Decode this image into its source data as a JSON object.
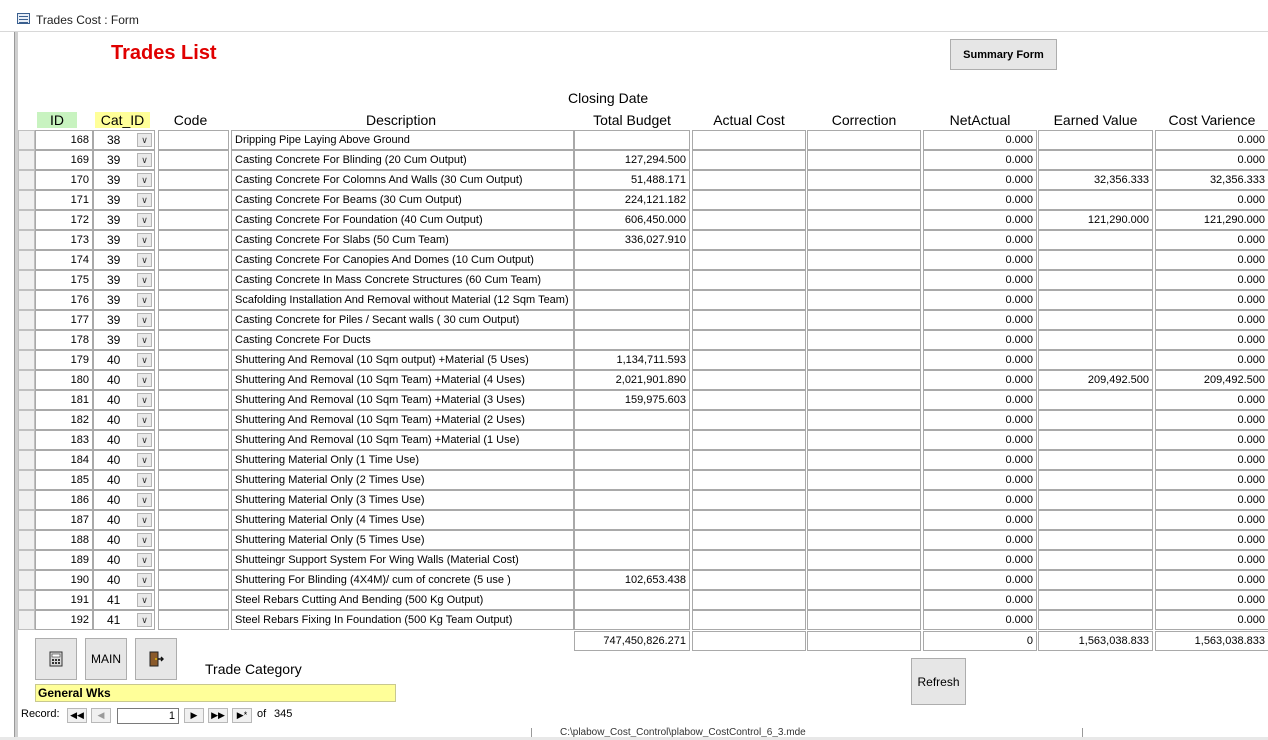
{
  "window": {
    "title": "Trades Cost : Form"
  },
  "header": {
    "title": "Trades List",
    "summary_button": "Summary Form",
    "closing_date_label": "Closing Date"
  },
  "columns": {
    "id": "ID",
    "cat": "Cat_ID",
    "code": "Code",
    "description": "Description",
    "total_budget": "Total Budget",
    "actual_cost": "Actual Cost",
    "correction": "Correction",
    "net_actual": "NetActual",
    "earned_value": "Earned Value",
    "cost_variance": "Cost Varience"
  },
  "rows": [
    {
      "id": "168",
      "cat": "38",
      "code": "",
      "desc": "Dripping Pipe Laying Above Ground",
      "budget": "",
      "actual": "",
      "corr": "",
      "net": "0.000",
      "earned": "",
      "cv": "0.000"
    },
    {
      "id": "169",
      "cat": "39",
      "code": "",
      "desc": "Casting Concrete For Blinding (20 Cum Output)",
      "budget": "127,294.500",
      "actual": "",
      "corr": "",
      "net": "0.000",
      "earned": "",
      "cv": "0.000"
    },
    {
      "id": "170",
      "cat": "39",
      "code": "",
      "desc": "Casting Concrete For Colomns And Walls (30 Cum Output)",
      "budget": "51,488.171",
      "actual": "",
      "corr": "",
      "net": "0.000",
      "earned": "32,356.333",
      "cv": "32,356.333"
    },
    {
      "id": "171",
      "cat": "39",
      "code": "",
      "desc": "Casting Concrete For Beams (30 Cum Output)",
      "budget": "224,121.182",
      "actual": "",
      "corr": "",
      "net": "0.000",
      "earned": "",
      "cv": "0.000"
    },
    {
      "id": "172",
      "cat": "39",
      "code": "",
      "desc": "Casting Concrete For Foundation (40 Cum Output)",
      "budget": "606,450.000",
      "actual": "",
      "corr": "",
      "net": "0.000",
      "earned": "121,290.000",
      "cv": "121,290.000"
    },
    {
      "id": "173",
      "cat": "39",
      "code": "",
      "desc": "Casting Concrete For Slabs (50 Cum Team)",
      "budget": "336,027.910",
      "actual": "",
      "corr": "",
      "net": "0.000",
      "earned": "",
      "cv": "0.000"
    },
    {
      "id": "174",
      "cat": "39",
      "code": "",
      "desc": "Casting Concrete For Canopies And Domes (10 Cum Output)",
      "budget": "",
      "actual": "",
      "corr": "",
      "net": "0.000",
      "earned": "",
      "cv": "0.000"
    },
    {
      "id": "175",
      "cat": "39",
      "code": "",
      "desc": "Casting Concrete  In Mass Concrete Structures  (60 Cum Team)",
      "budget": "",
      "actual": "",
      "corr": "",
      "net": "0.000",
      "earned": "",
      "cv": "0.000"
    },
    {
      "id": "176",
      "cat": "39",
      "code": "",
      "desc": "Scafolding Installation And Removal without Material (12 Sqm Team)",
      "budget": "",
      "actual": "",
      "corr": "",
      "net": "0.000",
      "earned": "",
      "cv": "0.000"
    },
    {
      "id": "177",
      "cat": "39",
      "code": "",
      "desc": "Casting Concrete for Piles / Secant walls ( 30 cum Output)",
      "budget": "",
      "actual": "",
      "corr": "",
      "net": "0.000",
      "earned": "",
      "cv": "0.000"
    },
    {
      "id": "178",
      "cat": "39",
      "code": "",
      "desc": "Casting Concrete For Ducts",
      "budget": "",
      "actual": "",
      "corr": "",
      "net": "0.000",
      "earned": "",
      "cv": "0.000"
    },
    {
      "id": "179",
      "cat": "40",
      "code": "",
      "desc": "Shuttering And Removal (10 Sqm output) +Material  (5 Uses)",
      "budget": "1,134,711.593",
      "actual": "",
      "corr": "",
      "net": "0.000",
      "earned": "",
      "cv": "0.000"
    },
    {
      "id": "180",
      "cat": "40",
      "code": "",
      "desc": "Shuttering And Removal (10 Sqm Team) +Material (4 Uses)",
      "budget": "2,021,901.890",
      "actual": "",
      "corr": "",
      "net": "0.000",
      "earned": "209,492.500",
      "cv": "209,492.500"
    },
    {
      "id": "181",
      "cat": "40",
      "code": "",
      "desc": "Shuttering And Removal (10 Sqm Team) +Material (3 Uses)",
      "budget": "159,975.603",
      "actual": "",
      "corr": "",
      "net": "0.000",
      "earned": "",
      "cv": "0.000"
    },
    {
      "id": "182",
      "cat": "40",
      "code": "",
      "desc": "Shuttering And Removal (10 Sqm Team) +Material (2 Uses)",
      "budget": "",
      "actual": "",
      "corr": "",
      "net": "0.000",
      "earned": "",
      "cv": "0.000"
    },
    {
      "id": "183",
      "cat": "40",
      "code": "",
      "desc": "Shuttering And Removal (10 Sqm Team) +Material (1 Use)",
      "budget": "",
      "actual": "",
      "corr": "",
      "net": "0.000",
      "earned": "",
      "cv": "0.000"
    },
    {
      "id": "184",
      "cat": "40",
      "code": "",
      "desc": "Shuttering Material Only (1 Time Use)",
      "budget": "",
      "actual": "",
      "corr": "",
      "net": "0.000",
      "earned": "",
      "cv": "0.000"
    },
    {
      "id": "185",
      "cat": "40",
      "code": "",
      "desc": "Shuttering Material Only (2 Times Use)",
      "budget": "",
      "actual": "",
      "corr": "",
      "net": "0.000",
      "earned": "",
      "cv": "0.000"
    },
    {
      "id": "186",
      "cat": "40",
      "code": "",
      "desc": "Shuttering Material Only (3 Times Use)",
      "budget": "",
      "actual": "",
      "corr": "",
      "net": "0.000",
      "earned": "",
      "cv": "0.000"
    },
    {
      "id": "187",
      "cat": "40",
      "code": "",
      "desc": "Shuttering Material Only (4 Times Use)",
      "budget": "",
      "actual": "",
      "corr": "",
      "net": "0.000",
      "earned": "",
      "cv": "0.000"
    },
    {
      "id": "188",
      "cat": "40",
      "code": "",
      "desc": "Shuttering Material Only (5 Times Use)",
      "budget": "",
      "actual": "",
      "corr": "",
      "net": "0.000",
      "earned": "",
      "cv": "0.000"
    },
    {
      "id": "189",
      "cat": "40",
      "code": "",
      "desc": "Shutteingr Support System For Wing Walls (Material Cost)",
      "budget": "",
      "actual": "",
      "corr": "",
      "net": "0.000",
      "earned": "",
      "cv": "0.000"
    },
    {
      "id": "190",
      "cat": "40",
      "code": "",
      "desc": "Shuttering For Blinding (4X4M)/ cum of concrete (5 use )",
      "budget": "102,653.438",
      "actual": "",
      "corr": "",
      "net": "0.000",
      "earned": "",
      "cv": "0.000"
    },
    {
      "id": "191",
      "cat": "41",
      "code": "",
      "desc": "Steel Rebars Cutting And Bending (500 Kg Output)",
      "budget": "",
      "actual": "",
      "corr": "",
      "net": "0.000",
      "earned": "",
      "cv": "0.000"
    },
    {
      "id": "192",
      "cat": "41",
      "code": "",
      "desc": "Steel Rebars Fixing In Foundation (500 Kg Team Output)",
      "budget": "",
      "actual": "",
      "corr": "",
      "net": "0.000",
      "earned": "",
      "cv": "0.000"
    }
  ],
  "totals": {
    "budget": "747,450,826.271",
    "actual": "",
    "corr": "",
    "net": "0",
    "earned": "1,563,038.833",
    "cv": "1,563,038.833"
  },
  "footer": {
    "main_button": "MAIN",
    "trade_category_label": "Trade Category",
    "trade_category_value": "General Wks",
    "refresh_button": "Refresh"
  },
  "record_nav": {
    "label": "Record:",
    "current": "1",
    "of_label": "of",
    "total": "345"
  },
  "background_window": {
    "path_text": "C:\\plabow_Cost_Control\\plabow_CostControl_6_3.mde"
  },
  "colors": {
    "title_red": "#e00000",
    "id_header": "#c8f3c0",
    "cat_header": "#ffff99",
    "category_field": "#ffff99"
  },
  "icons": {
    "calc": "calculator-icon",
    "exit": "exit-door-icon",
    "dropdown": "chevron-down-icon"
  }
}
